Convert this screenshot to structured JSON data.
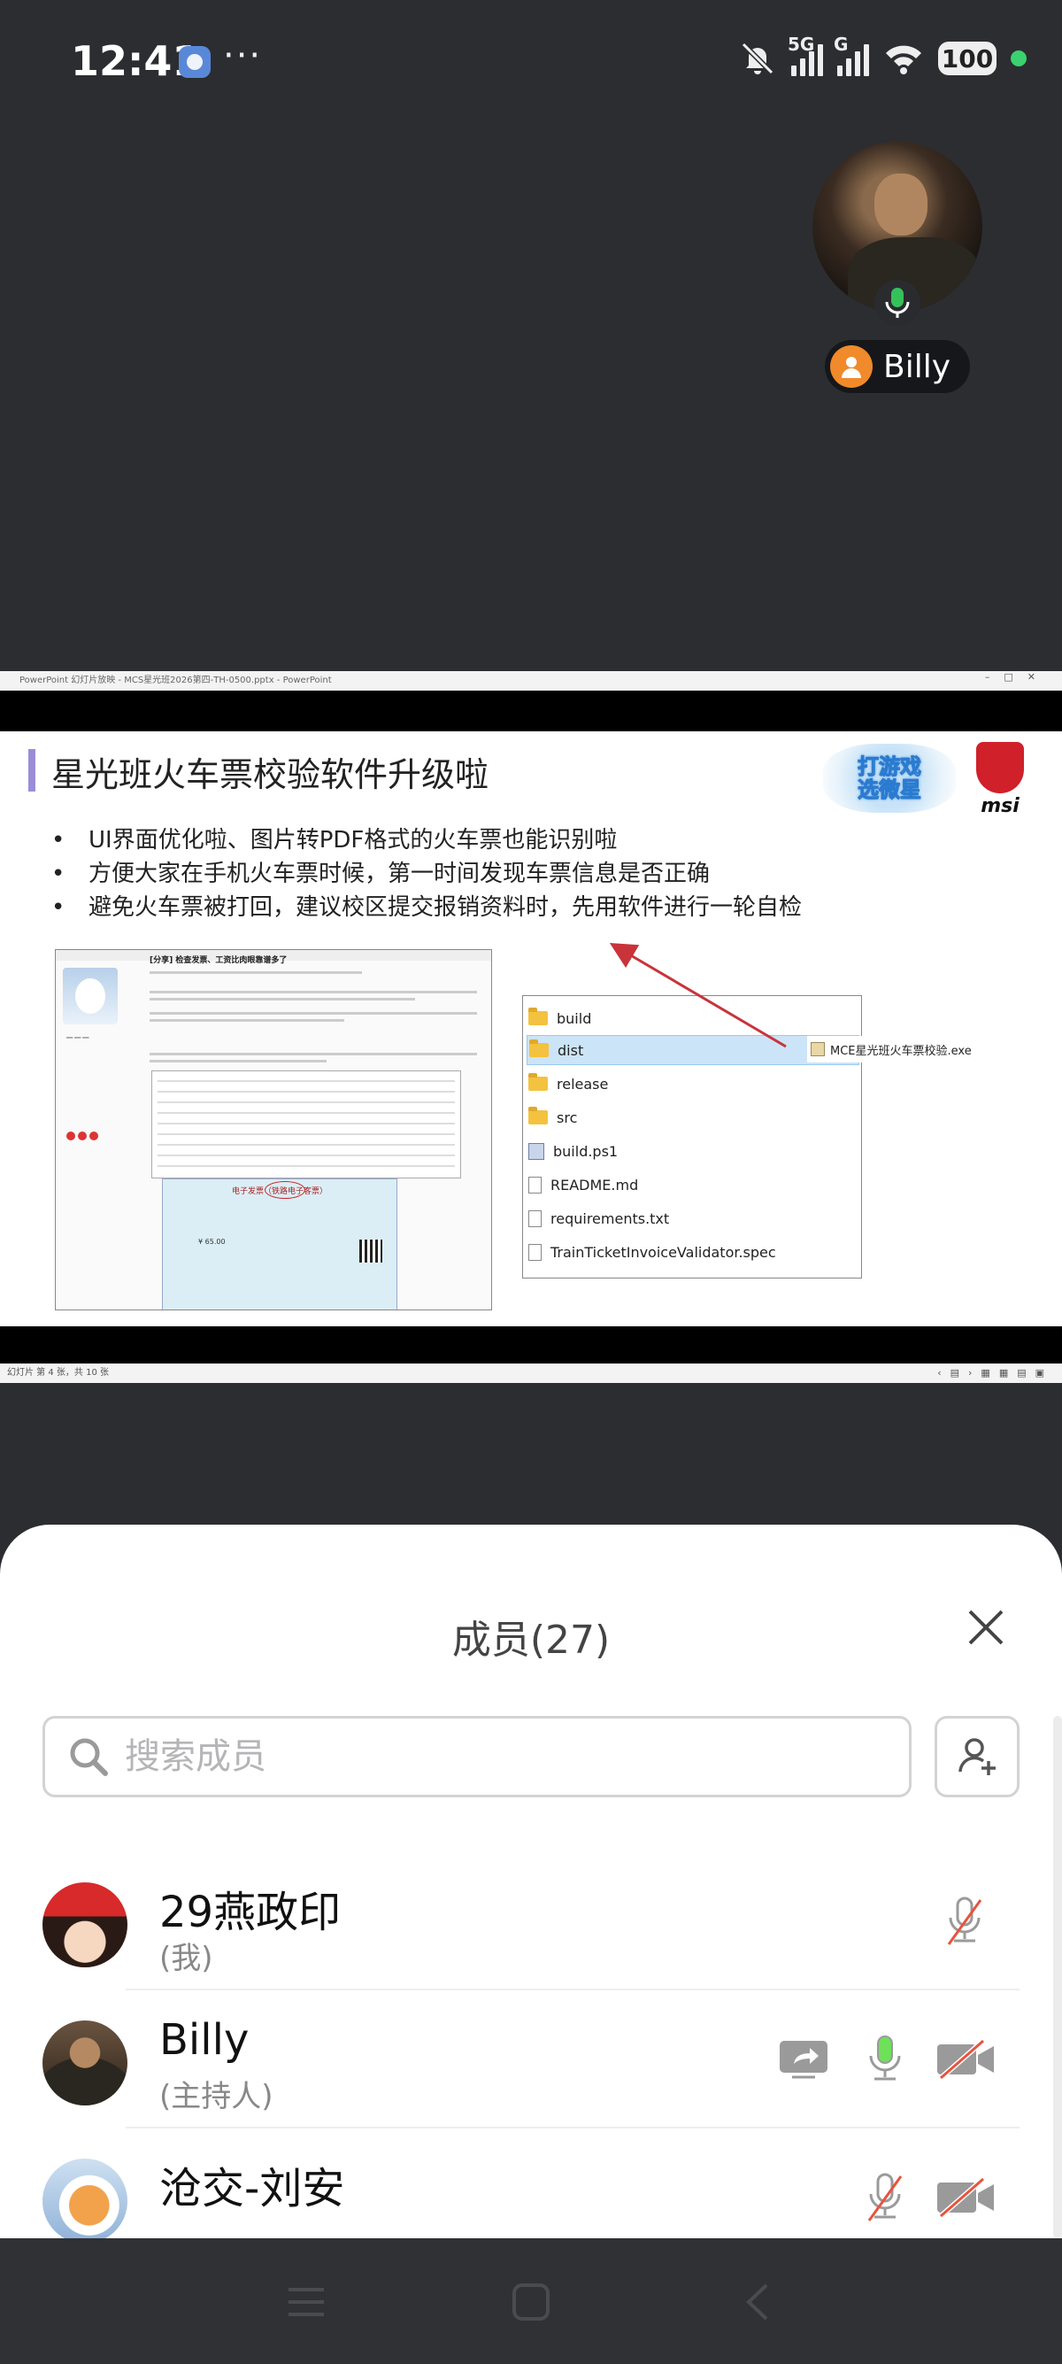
{
  "status_bar": {
    "time": "12:41",
    "more": "···",
    "network_1": "5G",
    "network_2": "G",
    "battery": "100",
    "icons": [
      "app-badge-icon",
      "mute-bell-icon",
      "signal-icon",
      "signal-icon",
      "wifi-icon",
      "battery-icon"
    ]
  },
  "remote_tile": {
    "participant_name": "Billy",
    "mic_color": "#35c15a"
  },
  "shared_screen": {
    "window_title": "PowerPoint 幻灯片放映 - MCS星光班2026第四-TH-0500.pptx - PowerPoint",
    "slide_title": "星光班火车票校验软件升级啦",
    "logo_text": "打游戏\n选微星",
    "brand_text": "msi",
    "bullets": [
      "UI界面优化啦、图片转PDF格式的火车票也能识别啦",
      "方便大家在手机火车票时候，第一时间发现车票信息是否正确",
      "避免火车票被打回，建议校区提交报销资料时，先用软件进行一轮自检"
    ],
    "left_screenshot": {
      "heading": "[分享] 检查发票、工资比肉眼靠谱多了",
      "invoice_title": "电子发票（铁路电子客票）",
      "invoice_amount": "¥ 65.00"
    },
    "explorer_items": [
      {
        "name": "build",
        "type": "folder"
      },
      {
        "name": "dist",
        "type": "folder",
        "selected": true
      },
      {
        "name": "release",
        "type": "folder"
      },
      {
        "name": "src",
        "type": "folder"
      },
      {
        "name": "build.ps1",
        "type": "script"
      },
      {
        "name": "README.md",
        "type": "file"
      },
      {
        "name": "requirements.txt",
        "type": "file"
      },
      {
        "name": "TrainTicketInvoiceValidator.spec",
        "type": "file"
      }
    ],
    "exe_name": "MCE星光班火车票校验.exe",
    "status_text": "幻灯片 第 4 张，共 10 张"
  },
  "members_panel": {
    "title": "成员(27)",
    "search_placeholder": "搜索成员",
    "members": [
      {
        "name": "29燕政印",
        "role": "(我)",
        "avatar": "santa-avatar",
        "controls": [
          "mic-muted"
        ]
      },
      {
        "name": "Billy",
        "role": "(主持人)",
        "avatar": "billy-avatar",
        "controls": [
          "screen-share",
          "mic-on",
          "camera-off"
        ]
      },
      {
        "name": "沧交-刘安",
        "role": "",
        "avatar": "cat-avatar",
        "controls": [
          "mic-muted",
          "camera-off"
        ]
      }
    ],
    "colors": {
      "mic_active": "#6ee05a",
      "muted_slash": "#e8533f",
      "icon_gray": "#9a9a9a"
    }
  },
  "nav_bar": {
    "buttons": [
      "menu-icon",
      "home-icon",
      "back-icon"
    ]
  }
}
